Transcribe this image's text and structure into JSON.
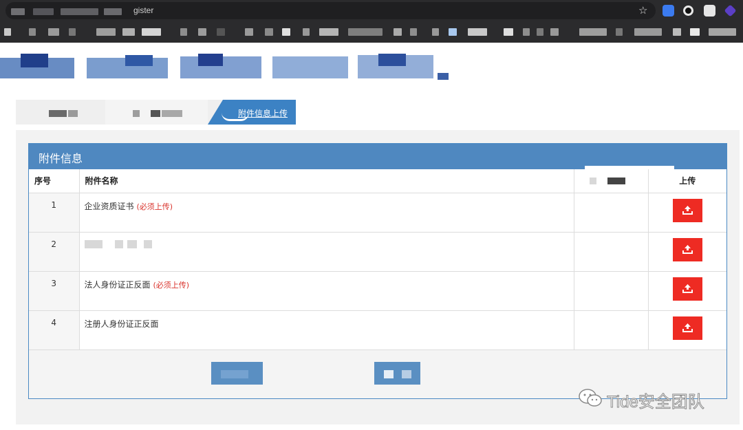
{
  "browser": {
    "url_visible_text": "gister"
  },
  "tabs": [
    {
      "label": "",
      "active": false
    },
    {
      "label": "",
      "active": false
    },
    {
      "label": "附件信息上传",
      "active": true
    }
  ],
  "attachments": {
    "title": "附件信息",
    "columns": {
      "seq": "序号",
      "name": "附件名称",
      "status": "",
      "upload": "上传"
    },
    "rows": [
      {
        "seq": "1",
        "name": "企业资质证书",
        "required": "(必须上传)"
      },
      {
        "seq": "2",
        "name": "",
        "required": ""
      },
      {
        "seq": "3",
        "name": "法人身份证正反面",
        "required": "(必须上传)"
      },
      {
        "seq": "4",
        "name": "注册人身份证正反面",
        "required": ""
      }
    ]
  },
  "watermark": {
    "text": "Tide安全团队"
  },
  "colors": {
    "accent": "#4f88c0",
    "upload_button": "#ee2b23",
    "required_text": "#d9322b"
  },
  "icons": {
    "upload": "upload-icon",
    "star": "star-icon",
    "watermark": "wechat-icon"
  }
}
